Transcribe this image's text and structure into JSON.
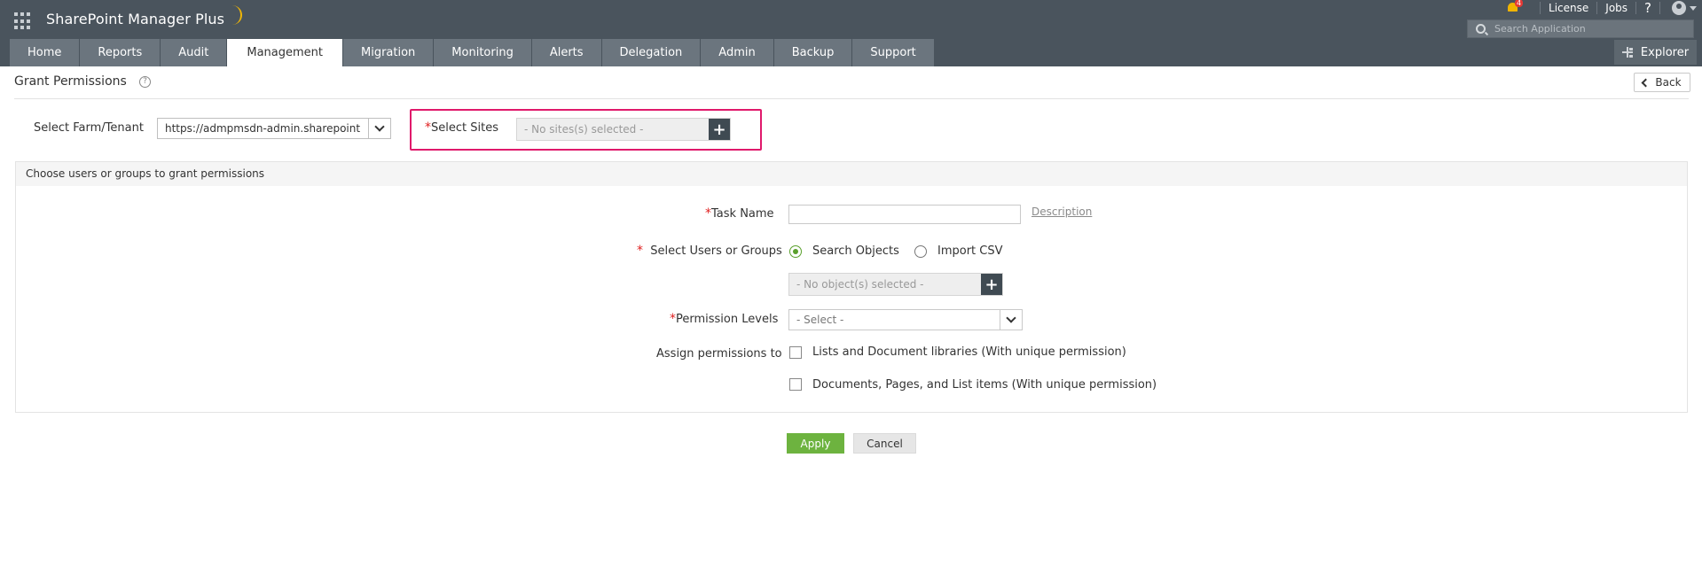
{
  "app": {
    "name": "SharePoint Manager Plus"
  },
  "topbar": {
    "notification_count": "4",
    "license": "License",
    "jobs": "Jobs",
    "help": "?",
    "search_placeholder": "Search Application"
  },
  "tabs": [
    {
      "label": "Home",
      "active": false
    },
    {
      "label": "Reports",
      "active": false
    },
    {
      "label": "Audit",
      "active": false
    },
    {
      "label": "Management",
      "active": true
    },
    {
      "label": "Migration",
      "active": false
    },
    {
      "label": "Monitoring",
      "active": false
    },
    {
      "label": "Alerts",
      "active": false
    },
    {
      "label": "Delegation",
      "active": false
    },
    {
      "label": "Admin",
      "active": false
    },
    {
      "label": "Backup",
      "active": false
    },
    {
      "label": "Support",
      "active": false
    }
  ],
  "explorer_label": "Explorer",
  "page": {
    "title": "Grant Permissions",
    "back_label": "Back"
  },
  "farm": {
    "label": "Select Farm/Tenant",
    "value": "https://admpmsdn-admin.sharepoint"
  },
  "sites": {
    "label": "Select Sites",
    "placeholder": "- No sites(s) selected -"
  },
  "panel": {
    "heading": "Choose users or groups to grant permissions",
    "task_name_label": "Task Name",
    "task_name_value": "",
    "description_link": "Description",
    "users_label": "Select Users or Groups",
    "radio_search": "Search Objects",
    "radio_import": "Import CSV",
    "objects_placeholder": "- No object(s) selected -",
    "permission_label": "Permission Levels",
    "permission_value": "- Select -",
    "assign_label": "Assign permissions to",
    "check_lists": "Lists and Document libraries (With unique permission)",
    "check_docs": "Documents, Pages, and List items (With unique permission)"
  },
  "buttons": {
    "apply": "Apply",
    "cancel": "Cancel"
  },
  "colors": {
    "topbar": "#4a545d",
    "tab": "#6b757e",
    "highlight": "#e0196b",
    "apply": "#6db33f"
  }
}
